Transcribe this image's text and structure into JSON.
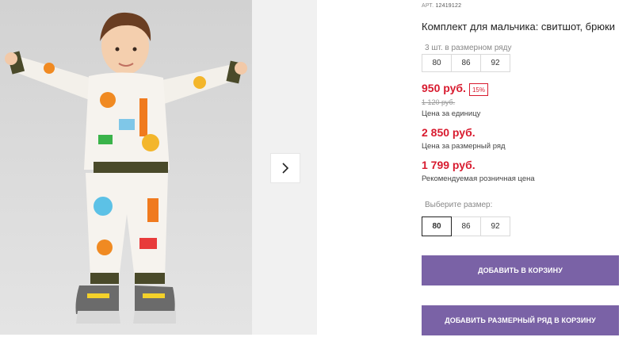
{
  "product": {
    "article_label": "АРТ.",
    "article_code": "12419122",
    "title": "Комплект для мальчика: свитшот, брюки"
  },
  "size_row": {
    "note": "3 шт. в размерном ряду",
    "sizes": [
      "80",
      "86",
      "92"
    ]
  },
  "pricing": {
    "unit_price": "950 руб.",
    "discount_badge": "15%",
    "old_price": "1 120 руб.",
    "unit_caption": "Цена за единицу",
    "row_price": "2 850 руб.",
    "row_caption": "Цена за размерный ряд",
    "rrp_price": "1 799 руб.",
    "rrp_caption": "Рекомендуемая розничная цена"
  },
  "size_picker": {
    "label": "Выберите размер:",
    "options": [
      "80",
      "86",
      "92"
    ],
    "selected": "80"
  },
  "actions": {
    "add_to_cart": "Добавить в корзину",
    "add_row_to_cart": "Добавить размерный ряд в корзину"
  },
  "gallery": {
    "next_icon": "chevron-right-icon"
  },
  "colors": {
    "price_red": "#d81b2f",
    "button_purple": "#7a62a6"
  }
}
